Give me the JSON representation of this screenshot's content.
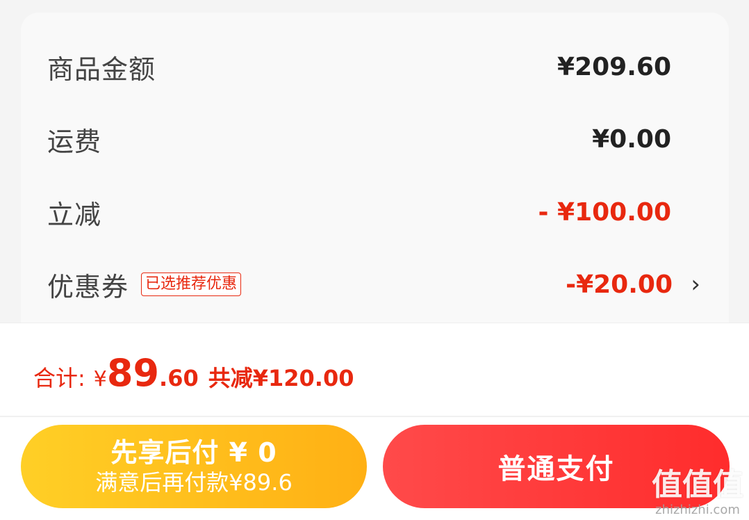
{
  "summary": {
    "rows": [
      {
        "label": "商品金额",
        "value": "¥209.60"
      },
      {
        "label": "运费",
        "value": "¥0.00"
      },
      {
        "label": "立减",
        "value": "- ¥100.00"
      },
      {
        "label": "优惠券",
        "tag": "已选推荐优惠",
        "value": "-¥20.00"
      }
    ]
  },
  "footer": {
    "total_label": "合计:",
    "currency": "¥",
    "total_int": "89",
    "total_dec": ".60",
    "saved_text": "共减¥120.00"
  },
  "buttons": {
    "bnpl_main": "先享后付 ¥ 0",
    "bnpl_sub": "满意后再付款¥89.6",
    "normal": "普通支付"
  },
  "watermark": {
    "mark": "值值值",
    "url": "zhizhizhi.com"
  },
  "colors": {
    "accent_red": "#e8280f",
    "bnpl_yellow": "#ffc01e",
    "pay_red": "#ff3a3a"
  }
}
